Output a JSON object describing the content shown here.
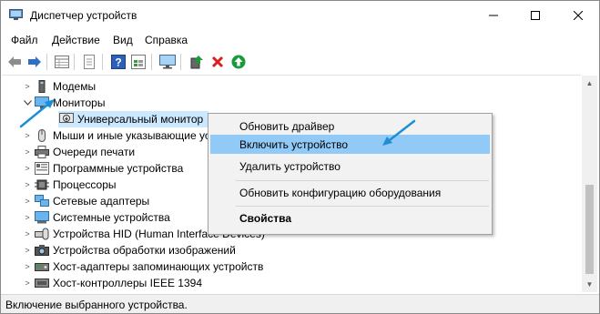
{
  "window": {
    "title": "Диспетчер устройств",
    "controls": {
      "minimize": "—",
      "maximize": "☐",
      "close": "✕"
    }
  },
  "menu": [
    "Файл",
    "Действие",
    "Вид",
    "Справка"
  ],
  "toolbar": [
    "back-arrow-icon",
    "forward-arrow-icon",
    "properties-grid-icon",
    "page-icon",
    "help-icon",
    "list-view-icon",
    "monitor-scan-icon",
    "update-driver-icon",
    "uninstall-x-icon",
    "enable-device-icon"
  ],
  "tree": {
    "items": [
      {
        "label": "Модемы",
        "icon": "modem-icon",
        "expanded": false
      },
      {
        "label": "Мониторы",
        "icon": "monitor-icon",
        "expanded": true
      },
      {
        "label": "Универсальный монитор",
        "icon": "monitor-disabled-icon",
        "child": true,
        "selected": true
      },
      {
        "label": "Мыши и иные указывающие устройства",
        "icon": "mouse-icon",
        "expanded": false
      },
      {
        "label": "Очереди печати",
        "icon": "printer-icon",
        "expanded": false
      },
      {
        "label": "Программные устройства",
        "icon": "software-device-icon",
        "expanded": false
      },
      {
        "label": "Процессоры",
        "icon": "processor-icon",
        "expanded": false
      },
      {
        "label": "Сетевые адаптеры",
        "icon": "network-adapter-icon",
        "expanded": false
      },
      {
        "label": "Системные устройства",
        "icon": "system-device-icon",
        "expanded": false
      },
      {
        "label": "Устройства HID (Human Interface Devices)",
        "icon": "hid-icon",
        "expanded": false
      },
      {
        "label": "Устройства обработки изображений",
        "icon": "camera-icon",
        "expanded": false
      },
      {
        "label": "Хост-адаптеры запоминающих устройств",
        "icon": "storage-controller-icon",
        "expanded": false
      },
      {
        "label": "Хост-контроллеры IEEE 1394",
        "icon": "ieee1394-icon",
        "expanded": false
      }
    ]
  },
  "context_menu": {
    "items": [
      {
        "label": "Обновить драйвер",
        "highlighted": false,
        "bold": false
      },
      {
        "label": "Включить устройство",
        "highlighted": true,
        "bold": false
      },
      {
        "label": "Удалить устройство",
        "highlighted": false,
        "bold": false
      },
      {
        "separator": true
      },
      {
        "label": "Обновить конфигурацию оборудования",
        "highlighted": false,
        "bold": false
      },
      {
        "separator": true
      },
      {
        "label": "Свойства",
        "highlighted": false,
        "bold": true
      }
    ]
  },
  "status": {
    "text": "Включение выбранного устройства."
  },
  "colors": {
    "highlight": "#91c9f7",
    "selected": "#cce8ff",
    "callout_arrow": "#1e8fd6",
    "enable_green": "#1a9b3a",
    "remove_red": "#d9201e"
  }
}
